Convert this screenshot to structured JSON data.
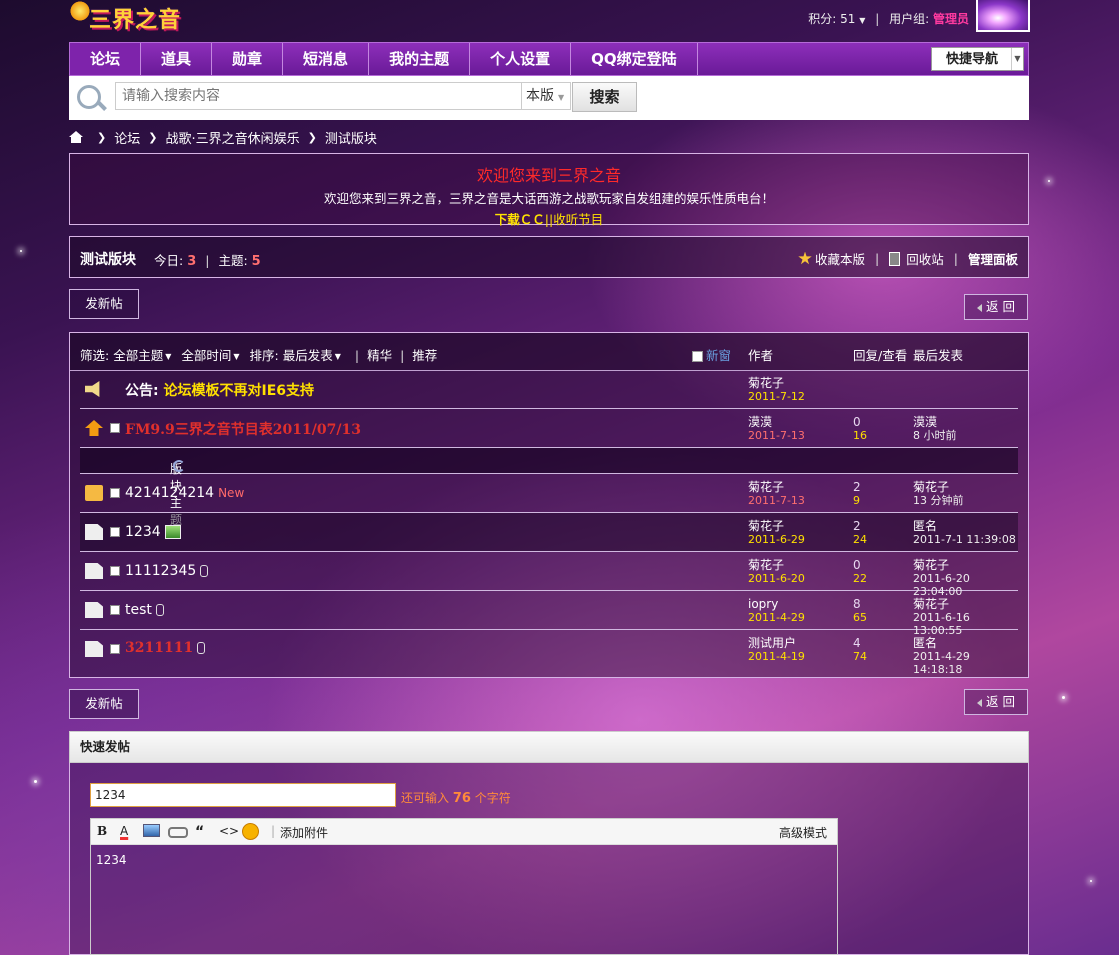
{
  "site": {
    "logo_text": "三界之音"
  },
  "userbar": {
    "points_label": "积分: 51",
    "group_label": "用户组:",
    "group_value": "管理员"
  },
  "nav": {
    "items": [
      "论坛",
      "道具",
      "勋章",
      "短消息",
      "我的主题",
      "个人设置",
      "QQ绑定登陆"
    ],
    "quick_nav": "快捷导航"
  },
  "search": {
    "placeholder": "请输入搜索内容",
    "scope": "本版",
    "button": "搜索"
  },
  "breadcrumb": [
    "论坛",
    "战歌·三界之音休闲娱乐",
    "测试版块"
  ],
  "announcement": {
    "title": "欢迎您来到三界之音",
    "text": "欢迎您来到三界之音，三界之音是大话西游之战歌玩家自发组建的娱乐性质电台！",
    "link1": "下载ＣＣ",
    "link_sep": "||",
    "link2": "收听节目"
  },
  "forum": {
    "name": "测试版块",
    "today_label": "今日:",
    "today_value": "3",
    "topics_label": "主题:",
    "topics_value": "5",
    "favorite": "收藏本版",
    "recycle": "回收站",
    "admin_panel": "管理面板"
  },
  "buttons": {
    "new_post": "发新帖",
    "back": "返 回"
  },
  "list_header": {
    "filter_label": "筛选:",
    "all_topics": "全部主题",
    "all_time": "全部时间",
    "sort_label": "排序:",
    "sort_value": "最后发表",
    "digest": "精华",
    "recommend": "推荐",
    "new_window": "新窗",
    "author": "作者",
    "replies_views": "回复/查看",
    "last_post": "最后发表"
  },
  "notice": {
    "prefix": "公告:",
    "title": "论坛模板不再对IE6支持",
    "author": "菊花子",
    "date": "2011-7-12"
  },
  "sticky": {
    "title": "FM9.9三界之音节目表2011/07/13",
    "author": "漠漠",
    "date": "2011-7-13",
    "replies": "0",
    "views": "16",
    "last_user": "漠漠",
    "last_time": "8 小时前"
  },
  "section_label": "版块主题",
  "threads": [
    {
      "title": "4214124214",
      "new": "New",
      "author": "菊花子",
      "date": "2011-7-13",
      "replies": "2",
      "views": "9",
      "last_user": "菊花子",
      "last_time": "13 分钟前"
    },
    {
      "title": "1234",
      "author": "菊花子",
      "date": "2011-6-29",
      "replies": "2",
      "views": "24",
      "last_user": "匿名",
      "last_time": "2011-7-1 11:39:08"
    },
    {
      "title": "11112345",
      "author": "菊花子",
      "date": "2011-6-20",
      "replies": "0",
      "views": "22",
      "last_user": "菊花子",
      "last_time": "2011-6-20 23:04:00"
    },
    {
      "title": "test",
      "author": "iopry",
      "date": "2011-4-29",
      "replies": "8",
      "views": "65",
      "last_user": "菊花子",
      "last_time": "2011-6-16 13:00:55"
    },
    {
      "title": "3211111",
      "author": "测试用户",
      "date": "2011-4-19",
      "replies": "4",
      "views": "74",
      "last_user": "匿名",
      "last_time": "2011-4-29 14:18:18"
    }
  ],
  "quick_post": {
    "title": "快速发帖",
    "subject_value": "1234",
    "tip_prefix": "还可输入",
    "tip_count": "76",
    "tip_suffix": "个字符",
    "toolbar": {
      "bold": "B",
      "color": "A",
      "quote": "“",
      "code": "<>",
      "attach": "添加附件",
      "advanced": "高级模式"
    },
    "body": "1234"
  }
}
